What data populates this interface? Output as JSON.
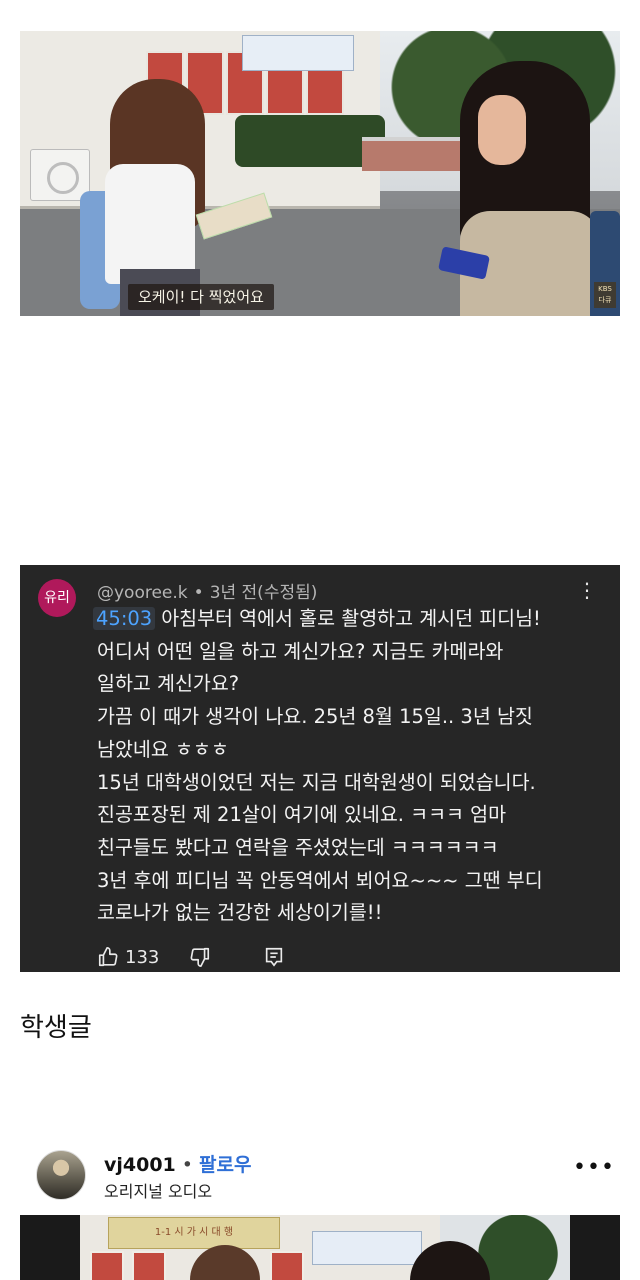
{
  "video1": {
    "subtitle": "오케이! 다 찍었어요",
    "channel_logo": {
      "line1": "KBS",
      "line2": "다큐"
    }
  },
  "comment": {
    "avatar_text": "유리",
    "author": "@yooree.k",
    "time": "3년 전(수정됨)",
    "timestamp_link": "45:03",
    "lines": [
      "아침부터 역에서 홀로 촬영하고 계시던 피디님!",
      "어디서 어떤 일을 하고 계신가요? 지금도 카메라와",
      "일하고 계신가요?",
      "가끔 이 때가 생각이 나요. 25년 8월 15일.. 3년 남짓",
      "남았네요 ㅎㅎㅎ",
      "15년 대학생이었던 저는 지금 대학원생이 되었습니다.",
      "진공포장된 제 21살이 여기에 있네요. ㅋㅋㅋ 엄마",
      "친구들도 봤다고 연락을 주셨었는데 ㅋㅋㅋㅋㅋㅋ",
      "3년 후에 피디님 꼭 안동역에서 뵈어요~~~ 그땐 부디",
      "코로나가 없는 건강한 세상이기를!!"
    ],
    "likes": "133"
  },
  "section_title": "학생글",
  "post": {
    "username": "vj4001",
    "separator": "•",
    "follow_label": "팔로우",
    "subtitle": "오리지널 오디오"
  },
  "video2": {
    "banner_text": "1-1 시 가 시 대 행"
  },
  "colors": {
    "comment_bg": "#262626",
    "timestamp_link": "#4da3ff",
    "avatar_bg": "#b0195b",
    "follow": "#2f6fd6"
  }
}
